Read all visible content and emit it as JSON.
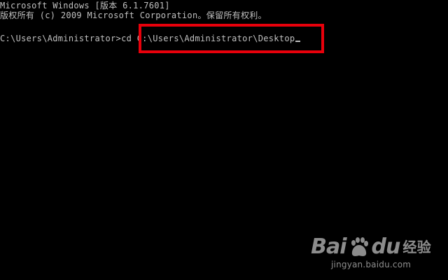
{
  "console": {
    "line1": "Microsoft Windows [版本 6.1.7601]",
    "line2": "版权所有 (c) 2009 Microsoft Corporation。保留所有权利。",
    "prompt": "C:\\Users\\Administrator>cd ",
    "argument": "C:\\Users\\Administrator\\Desktop"
  },
  "watermark": {
    "logo_bai": "Bai",
    "logo_du": "du",
    "logo_jingyan": "经验",
    "url": "jingyan.baidu.com"
  },
  "colors": {
    "background": "#000000",
    "text": "#c0c0c0",
    "highlight_border": "#e8000b"
  },
  "icons": {
    "watermark_logo": "baidu-paw-icon"
  }
}
